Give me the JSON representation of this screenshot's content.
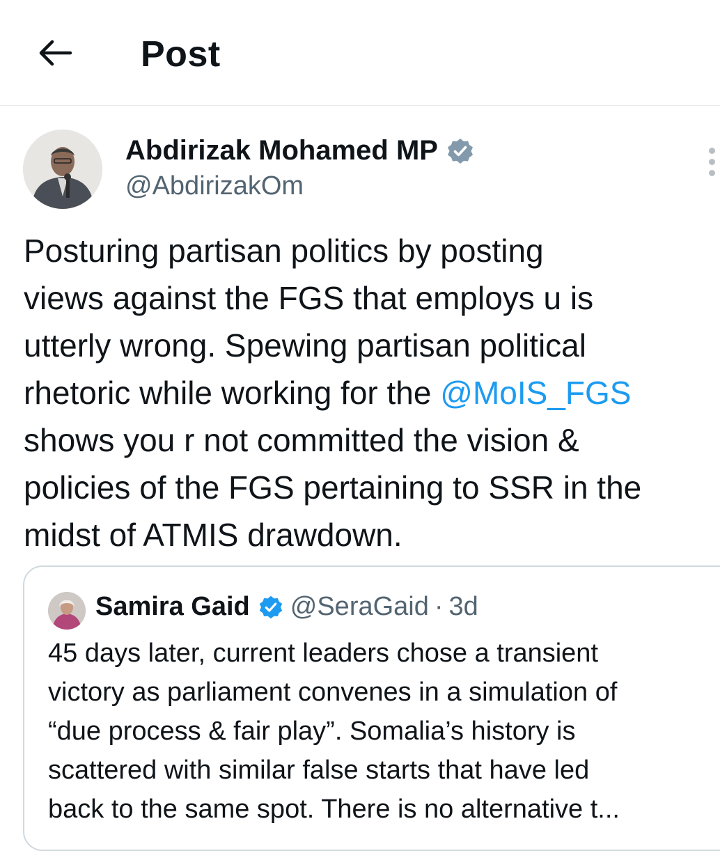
{
  "header": {
    "title": "Post",
    "back_icon": "arrow-left-icon"
  },
  "post": {
    "author_name": "Abdirizak Mohamed MP",
    "author_handle": "@AbdirizakOm",
    "verified": true,
    "more_icon": "more-vertical-icon",
    "text_before_mention": "Posturing partisan politics by posting\nviews against the FGS that employs u is\nutterly wrong. Spewing partisan political\nrhetoric while working for the ",
    "mention": "@MoIS_FGS",
    "text_after_mention": "\nshows you r not committed the vision &\npolicies of the FGS pertaining to SSR in the\nmidst of ATMIS drawdown."
  },
  "quoted_post": {
    "author_name": "Samira Gaid",
    "author_handle": "@SeraGaid",
    "separator": "·",
    "time": "3d",
    "verified": true,
    "text": "45 days later, current leaders chose a transient\nvictory as parliament convenes in a simulation of\n“due process & fair play”. Somalia’s history is\nscattered with similar false starts that have led\nback to the same spot. There is no alternative t..."
  },
  "colors": {
    "text": "#0f1419",
    "secondary": "#536471",
    "link": "#1d9bf0",
    "verified": "#829aab",
    "border": "#cfd9de"
  }
}
